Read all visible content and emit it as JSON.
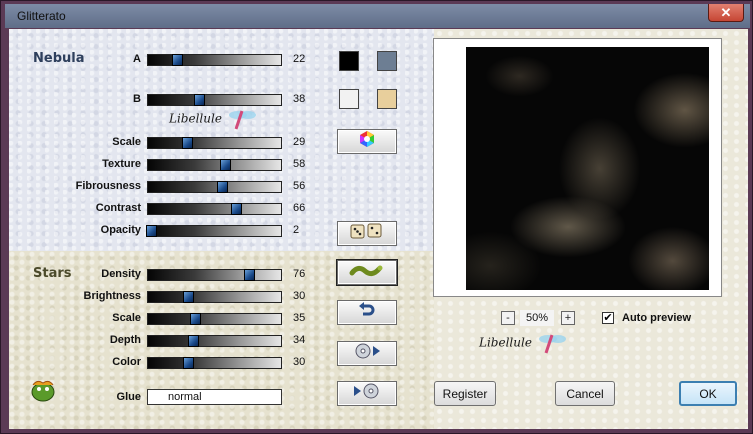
{
  "window": {
    "title": "Glitterato",
    "title_ghost": "...",
    "close": "✕"
  },
  "nebula": {
    "label": "Nebula",
    "sliders": [
      {
        "key": "a",
        "label": "A",
        "value": 22
      },
      {
        "key": "b",
        "label": "B",
        "value": 38
      },
      {
        "key": "scale",
        "label": "Scale",
        "value": 29
      },
      {
        "key": "texture",
        "label": "Texture",
        "value": 58
      },
      {
        "key": "fibrousness",
        "label": "Fibrousness",
        "value": 56
      },
      {
        "key": "contrast",
        "label": "Contrast",
        "value": 66
      },
      {
        "key": "opacity",
        "label": "Opacity",
        "value": 2
      }
    ],
    "colors": {
      "a_color1": "#000000",
      "a_color2": "#6d7e93",
      "b_color1": "#f2f2f2",
      "b_color2": "#e8cf9c"
    }
  },
  "stars": {
    "label": "Stars",
    "sliders": [
      {
        "key": "density",
        "label": "Density",
        "value": 76
      },
      {
        "key": "brightness",
        "label": "Brightness",
        "value": 30
      },
      {
        "key": "scale",
        "label": "Scale",
        "value": 35
      },
      {
        "key": "depth",
        "label": "Depth",
        "value": 34
      },
      {
        "key": "color",
        "label": "Color",
        "value": 30
      }
    ]
  },
  "glue": {
    "label": "Glue",
    "value": "normal"
  },
  "zoom": {
    "minus": "-",
    "value": "50%",
    "plus": "+"
  },
  "auto_preview": {
    "label": "Auto preview",
    "checked": true,
    "check": "✔"
  },
  "buttons": {
    "register": "Register",
    "cancel": "Cancel",
    "ok": "OK"
  },
  "logo_text": "Libellule",
  "icons": [
    "color-wheel-icon",
    "dice-icon",
    "worm-icon",
    "undo-icon",
    "cd-forward-icon",
    "cd-back-icon",
    "frog-logo-icon",
    "dragonfly-icon"
  ]
}
